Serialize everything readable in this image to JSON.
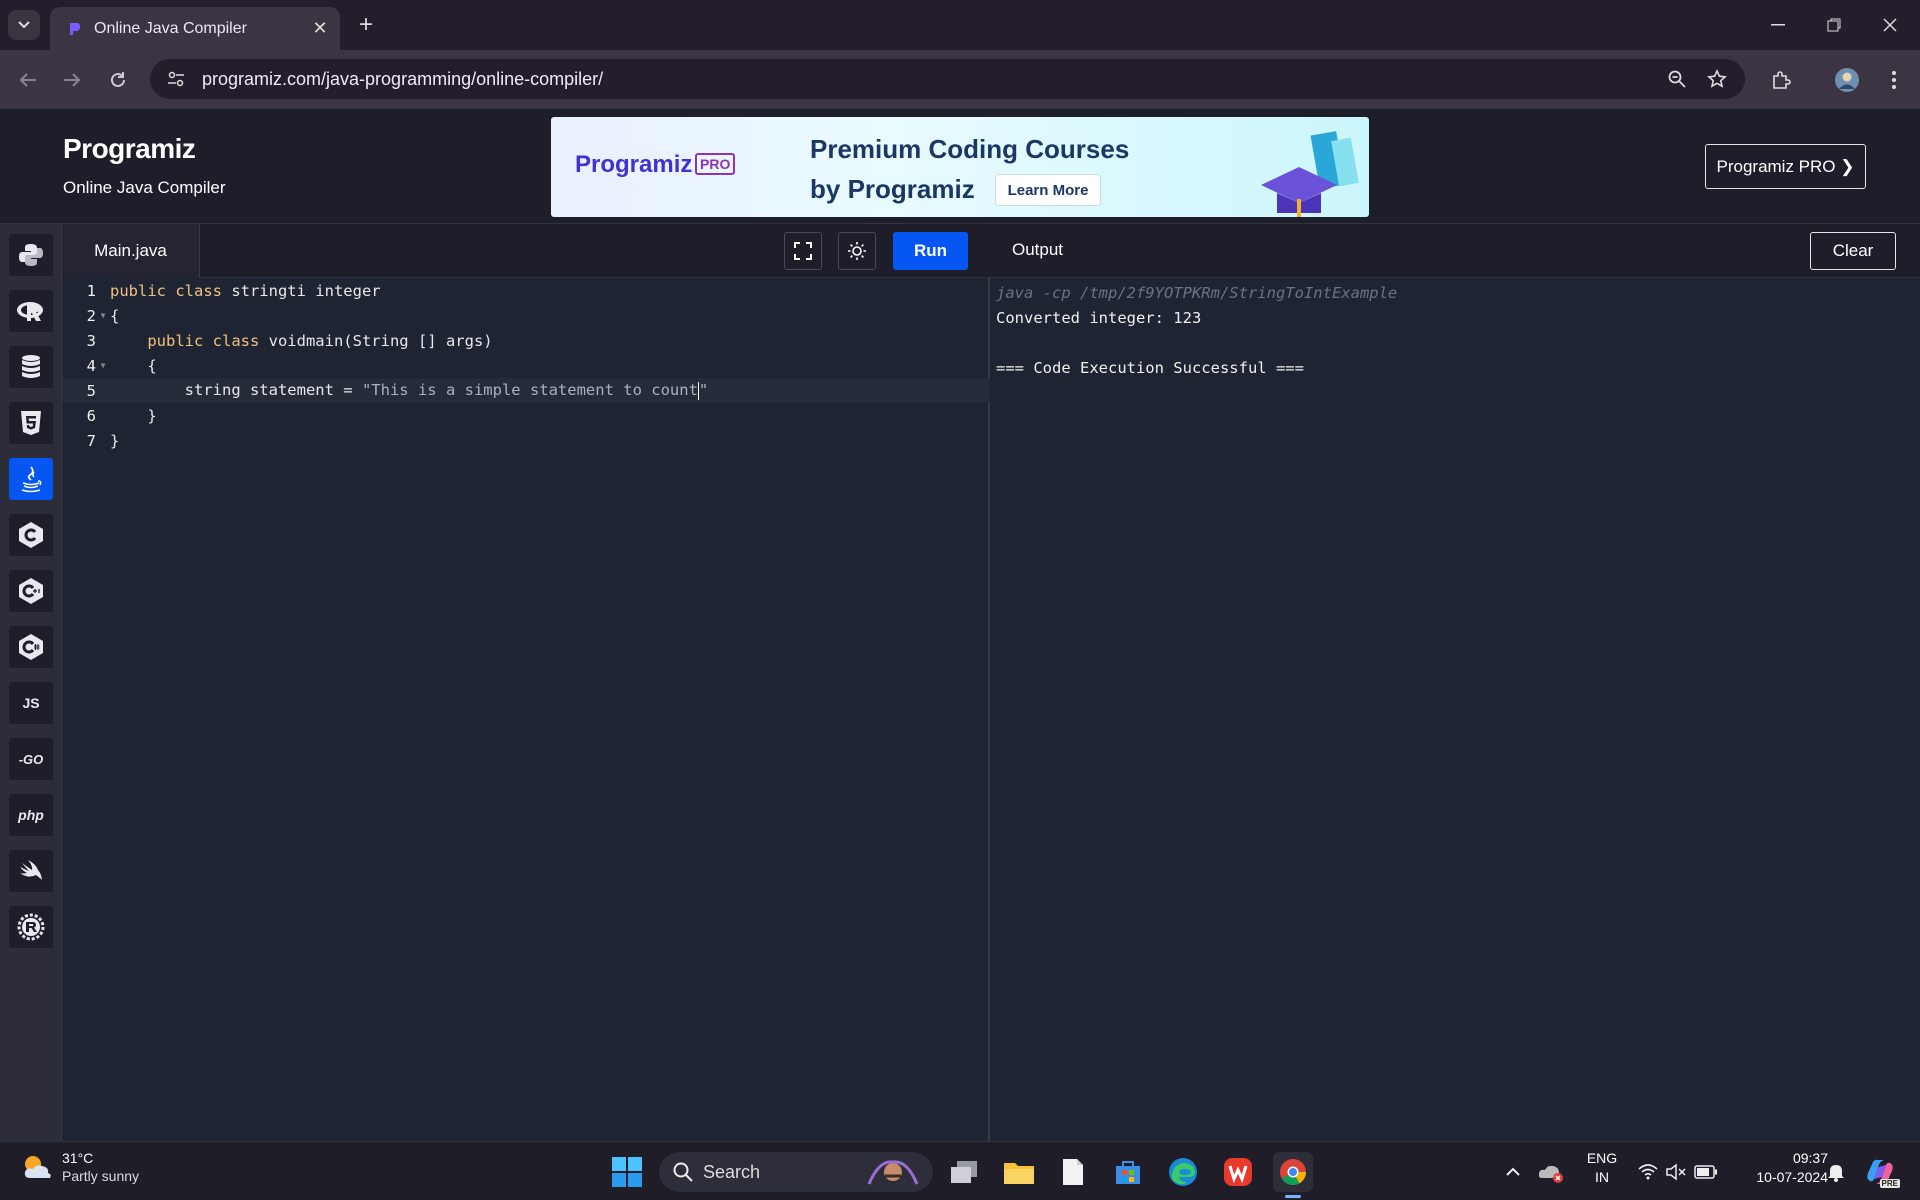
{
  "browser": {
    "tab_title": "Online Java Compiler",
    "url": "programiz.com/java-programming/online-compiler/"
  },
  "site": {
    "logo": "Programiz",
    "subtitle": "Online Java Compiler",
    "banner": {
      "logo": "Programiz",
      "badge": "PRO",
      "line1": "Premium Coding Courses",
      "line2": "by Programiz",
      "button": "Learn More"
    },
    "pro_button": "Programiz PRO ❯"
  },
  "sidebar": {
    "languages": [
      {
        "name": "python",
        "label": ""
      },
      {
        "name": "r",
        "label": ""
      },
      {
        "name": "sql",
        "label": ""
      },
      {
        "name": "html",
        "label": ""
      },
      {
        "name": "java",
        "label": "",
        "active": true
      },
      {
        "name": "c",
        "label": ""
      },
      {
        "name": "cpp",
        "label": ""
      },
      {
        "name": "csharp",
        "label": ""
      },
      {
        "name": "javascript",
        "label": "JS"
      },
      {
        "name": "go",
        "label": "-GO"
      },
      {
        "name": "php",
        "label": "php"
      },
      {
        "name": "swift",
        "label": ""
      },
      {
        "name": "rust",
        "label": ""
      }
    ]
  },
  "editor": {
    "file_name": "Main.java",
    "run_label": "Run",
    "lines": [
      {
        "n": "1",
        "pre": "",
        "kw": "public class",
        "post": " stringti integer"
      },
      {
        "n": "2",
        "pre": "{",
        "kw": "",
        "post": ""
      },
      {
        "n": "3",
        "pre": "    ",
        "kw": "public class",
        "post": " voidmain(String [] args)"
      },
      {
        "n": "4",
        "pre": "    {",
        "kw": "",
        "post": ""
      },
      {
        "n": "5",
        "pre": "        string statement = ",
        "kw": "",
        "post": "",
        "str": "\"This is a simple statement to count",
        "str_end": "\""
      },
      {
        "n": "6",
        "pre": "    }",
        "kw": "",
        "post": ""
      },
      {
        "n": "7",
        "pre": "}",
        "kw": "",
        "post": ""
      }
    ]
  },
  "output": {
    "title": "Output",
    "clear_label": "Clear",
    "lines": [
      "java -cp /tmp/2f9YOTPKRm/StringToIntExample",
      "Converted integer: 123",
      "",
      "=== Code Execution Successful ==="
    ]
  },
  "taskbar": {
    "temperature": "31°C",
    "condition": "Partly sunny",
    "search_placeholder": "Search",
    "lang_top": "ENG",
    "lang_bottom": "IN",
    "time": "09:37",
    "date": "10-07-2024"
  },
  "colors": {
    "accent": "#0556f3",
    "keyword": "#f2c17d",
    "background": "#1e2432"
  }
}
